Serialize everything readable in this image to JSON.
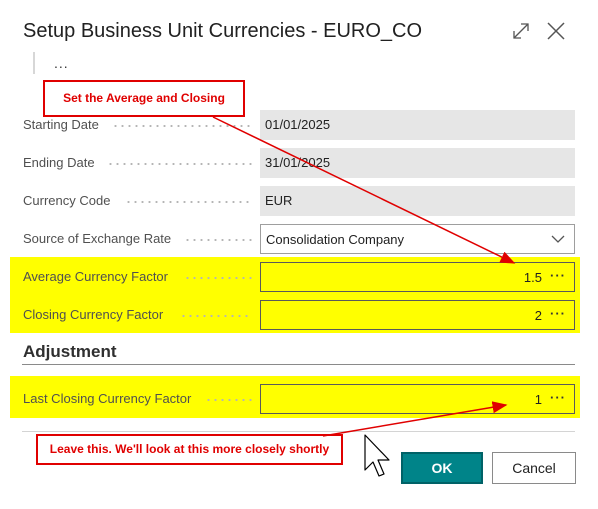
{
  "dialog": {
    "title": "Setup Business Unit Currencies - EURO_CO",
    "more_actions": "..."
  },
  "fields": {
    "starting_date": {
      "label": "Starting Date",
      "value": "01/01/2025"
    },
    "ending_date": {
      "label": "Ending Date",
      "value": "31/01/2025"
    },
    "currency_code": {
      "label": "Currency Code",
      "value": "EUR"
    },
    "source_of_exchange_rate": {
      "label": "Source of Exchange Rate",
      "value": "Consolidation Company"
    },
    "average_currency_factor": {
      "label": "Average Currency Factor",
      "value": "1.5"
    },
    "closing_currency_factor": {
      "label": "Closing Currency Factor",
      "value": "2"
    }
  },
  "adjustment": {
    "heading": "Adjustment",
    "last_closing_currency_factor": {
      "label": "Last Closing Currency Factor",
      "value": "1"
    }
  },
  "buttons": {
    "ok": "OK",
    "cancel": "Cancel"
  },
  "annotations": {
    "top": "Set the Average and Closing",
    "bottom": "Leave this. We'll look at this more closely shortly"
  },
  "colors": {
    "highlight": "#ffff00",
    "annotation": "#e00000",
    "primary_button": "#008489"
  },
  "icons": {
    "expand": "expand-icon",
    "close": "close-icon",
    "dropdown": "chevron-down-icon",
    "cursor": "mouse-pointer-icon"
  }
}
